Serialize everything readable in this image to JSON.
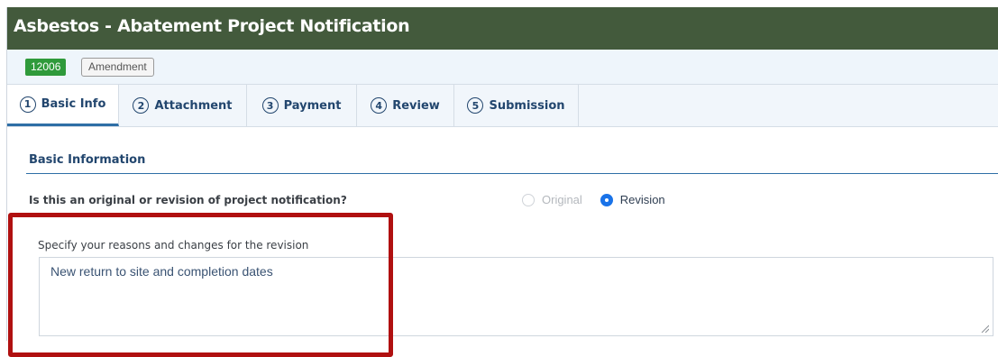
{
  "header": {
    "title": "Asbestos - Abatement Project Notification"
  },
  "record": {
    "id": "12006",
    "status": "Amendment"
  },
  "tabs": [
    {
      "num": "1",
      "label": "Basic Info",
      "active": true
    },
    {
      "num": "2",
      "label": "Attachment",
      "active": false
    },
    {
      "num": "3",
      "label": "Payment",
      "active": false
    },
    {
      "num": "4",
      "label": "Review",
      "active": false
    },
    {
      "num": "5",
      "label": "Submission",
      "active": false
    }
  ],
  "section": {
    "title": "Basic Information"
  },
  "question": {
    "text": "Is this an original or revision of project notification?",
    "options": [
      {
        "label": "Original",
        "selected": false,
        "disabled": true
      },
      {
        "label": "Revision",
        "selected": true,
        "disabled": false
      }
    ]
  },
  "revision_reason": {
    "label": "Specify your reasons and changes for the revision",
    "value": "New return to site and completion dates"
  },
  "colors": {
    "header_bg": "#435a3c",
    "accent_blue": "#2f6fa6",
    "id_badge": "#2f9a3b",
    "highlight_red": "#b01010",
    "radio_selected": "#1a73e8"
  }
}
